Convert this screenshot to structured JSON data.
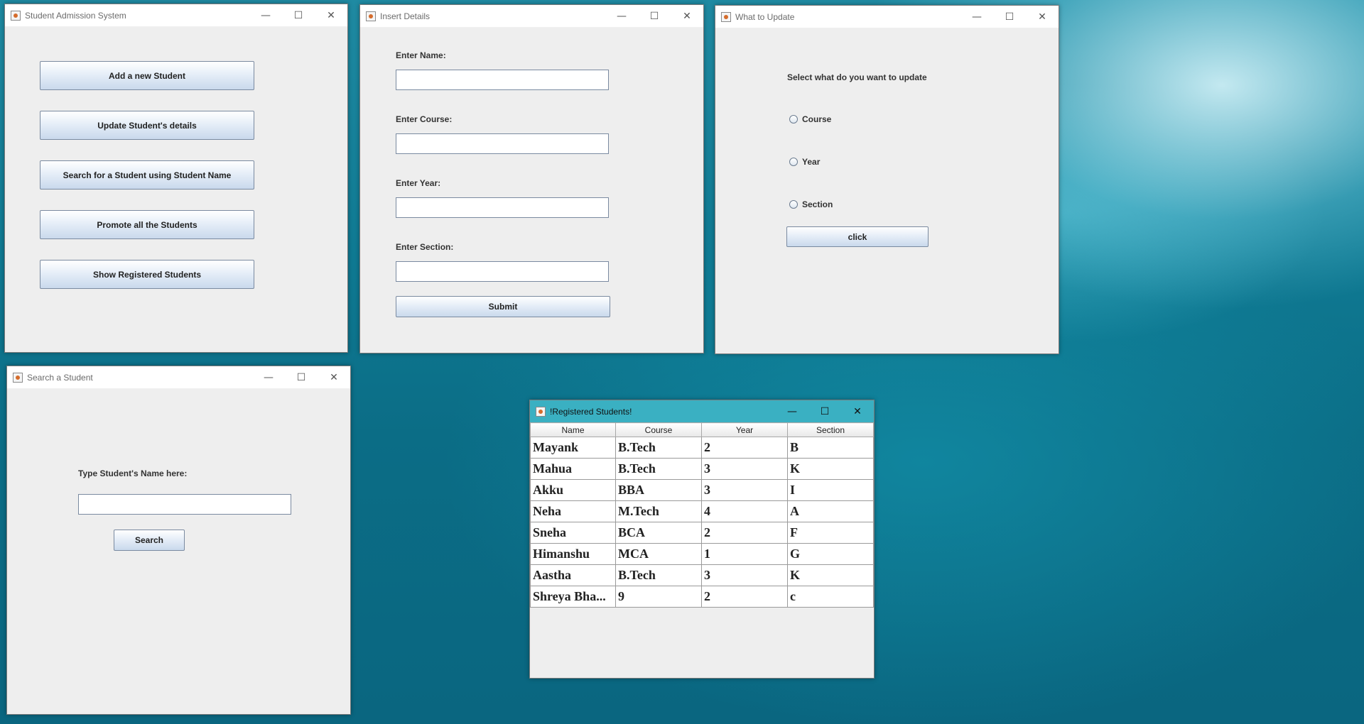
{
  "window_controls": {
    "minimize": "—",
    "maximize": "☐",
    "close": "✕"
  },
  "admission": {
    "title": "Student Admission System",
    "buttons": [
      "Add a new Student",
      "Update Student's details",
      "Search for a Student using Student Name",
      "Promote all the Students",
      "Show Registered Students"
    ]
  },
  "insert": {
    "title": "Insert Details",
    "name_label": "Enter Name:",
    "name_value": "",
    "course_label": "Enter Course:",
    "course_value": "",
    "year_label": "Enter Year:",
    "year_value": "",
    "section_label": "Enter Section:",
    "section_value": "",
    "submit_label": "Submit"
  },
  "update": {
    "title": "What to Update",
    "prompt": "Select what do you want to update",
    "options": [
      "Course",
      "Year",
      "Section"
    ],
    "click_label": "click"
  },
  "search": {
    "title": "Search a Student",
    "prompt": "Type Student's Name here:",
    "input_value": "",
    "button_label": "Search"
  },
  "registered": {
    "title": "!Registered Students!",
    "columns": [
      "Name",
      "Course",
      "Year",
      "Section"
    ],
    "rows": [
      [
        "Mayank",
        "B.Tech",
        "2",
        "B"
      ],
      [
        "Mahua",
        "B.Tech",
        "3",
        "K"
      ],
      [
        "Akku",
        "BBA",
        "3",
        "I"
      ],
      [
        "Neha",
        "M.Tech",
        "4",
        "A"
      ],
      [
        "Sneha",
        "BCA",
        "2",
        "F"
      ],
      [
        "Himanshu",
        "MCA",
        "1",
        "G"
      ],
      [
        "Aastha",
        "B.Tech",
        "3",
        "K"
      ],
      [
        "Shreya Bha...",
        "9",
        "2",
        "c"
      ]
    ]
  }
}
